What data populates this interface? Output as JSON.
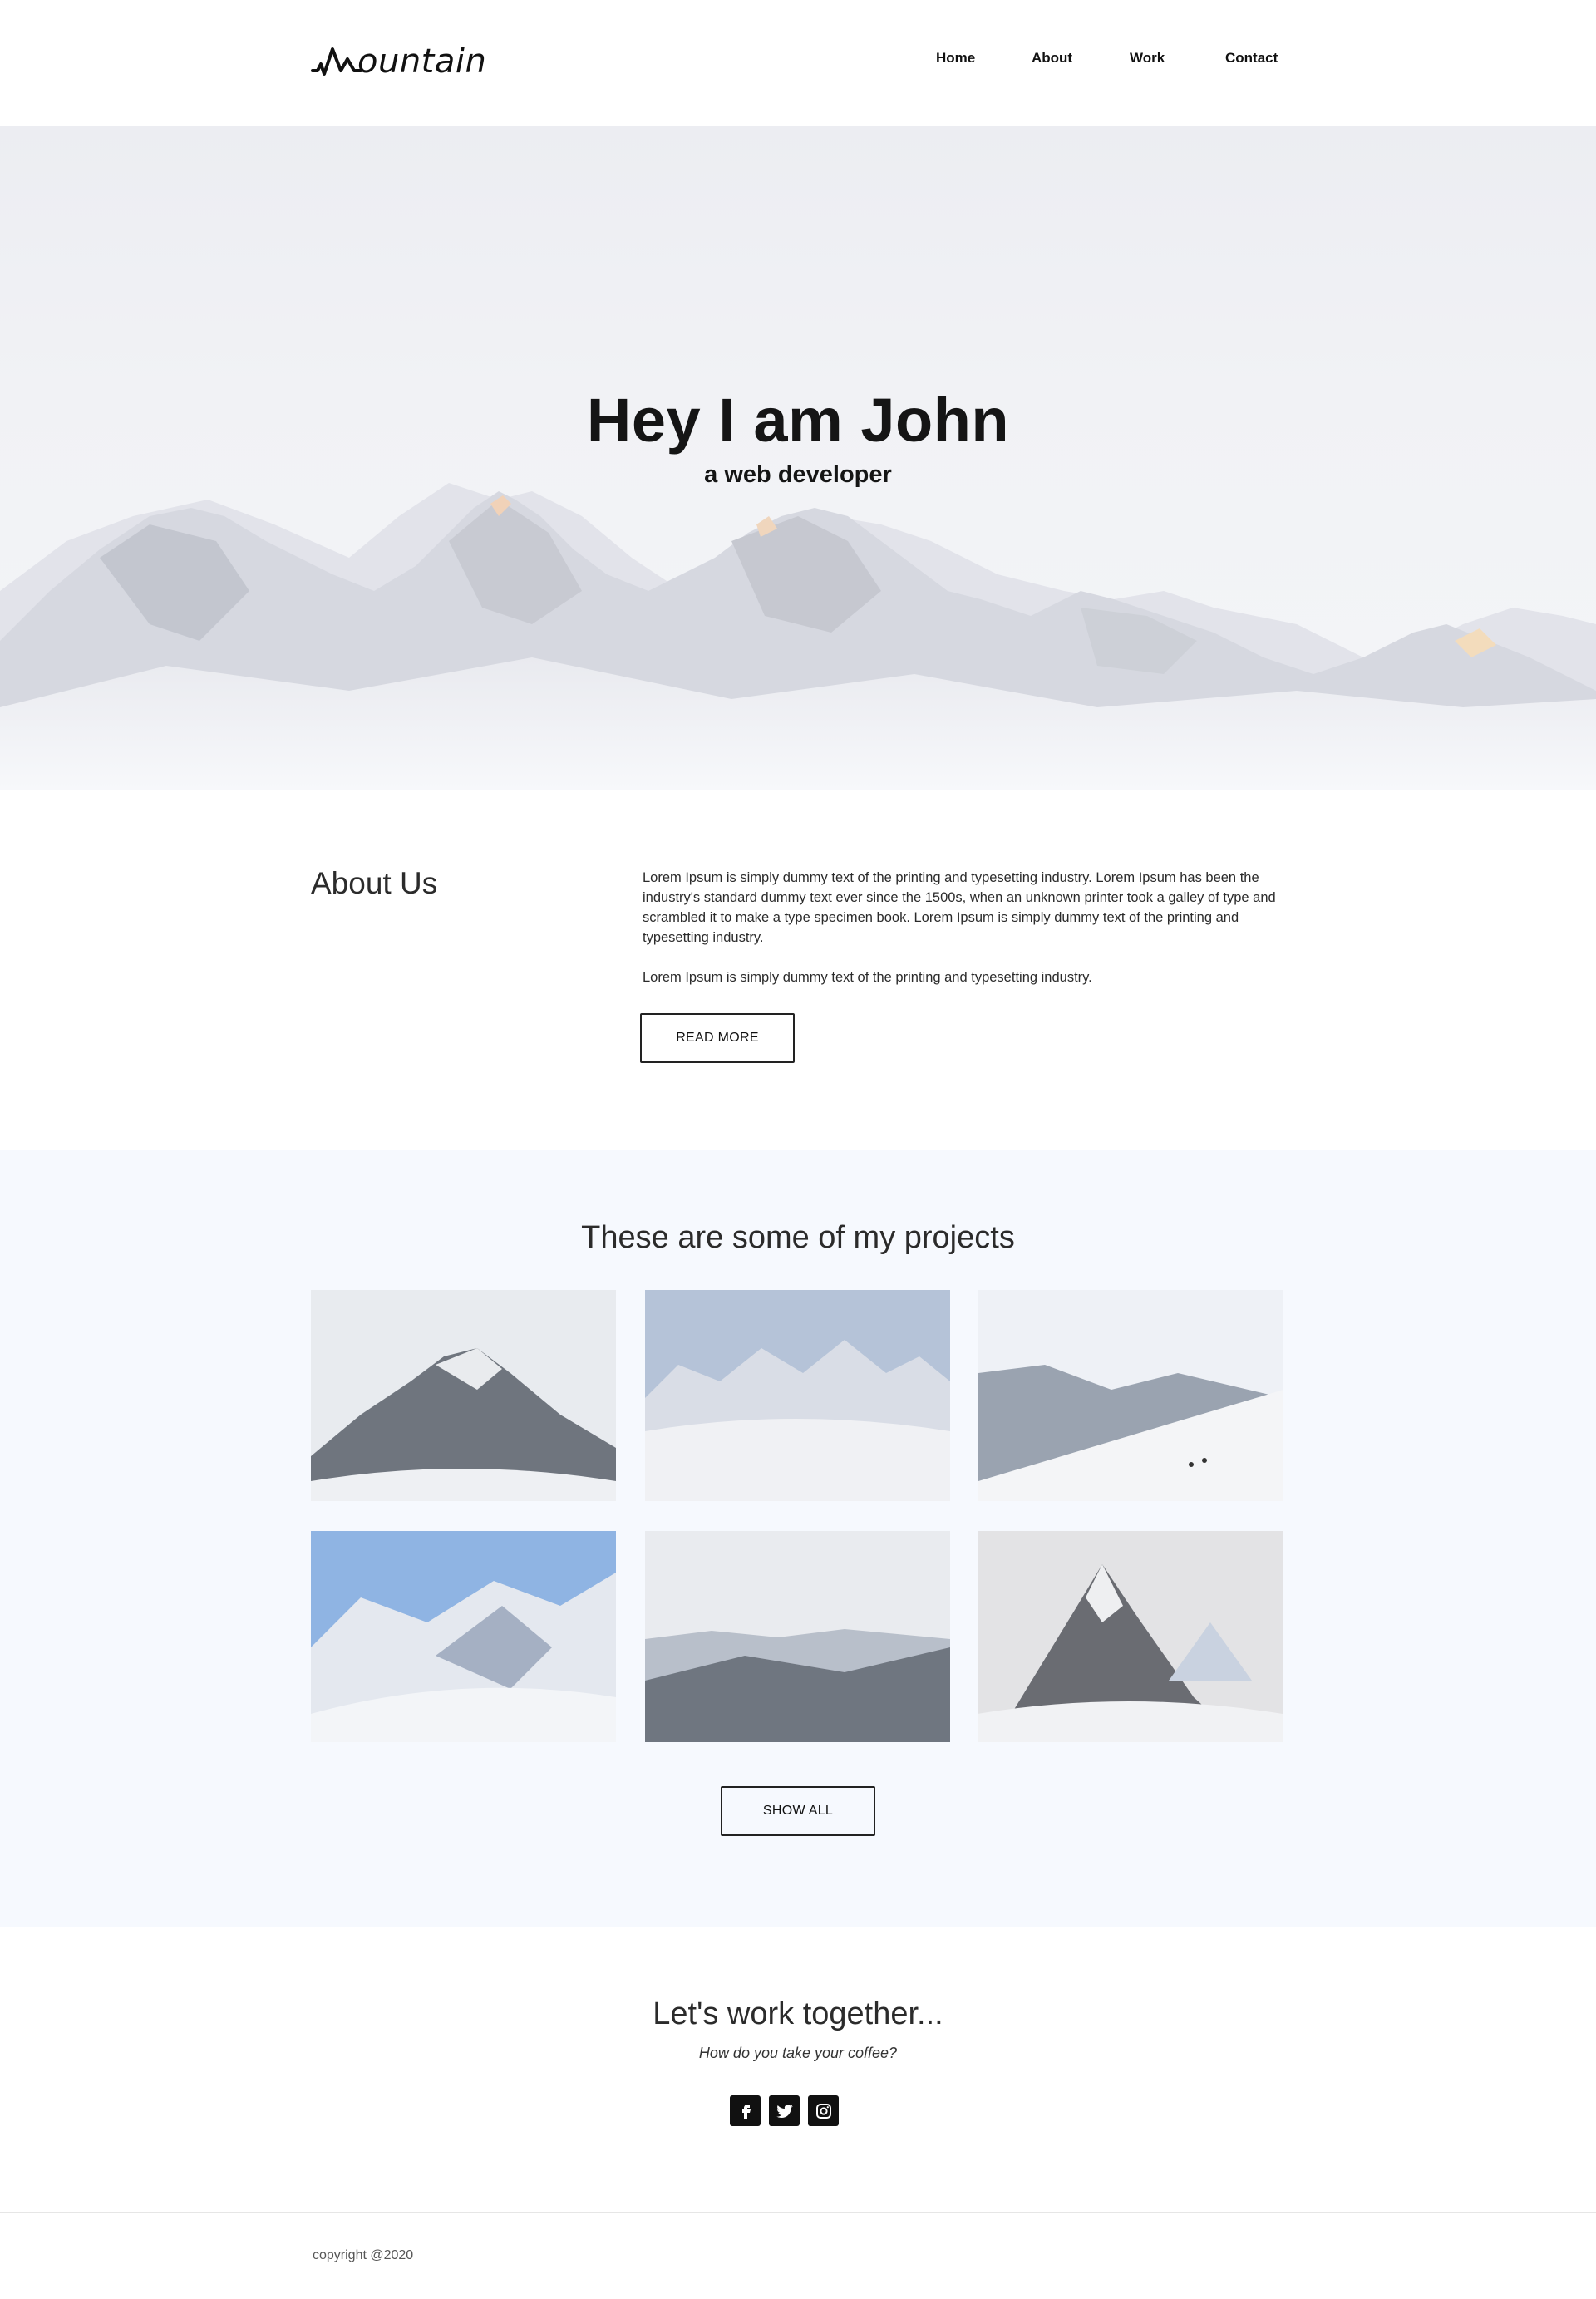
{
  "brand": {
    "name": "ountain",
    "logo_icon": "mountain-logo-icon"
  },
  "nav": {
    "items": [
      {
        "label": "Home"
      },
      {
        "label": "About"
      },
      {
        "label": "Work"
      },
      {
        "label": "Contact"
      }
    ]
  },
  "hero": {
    "title": "Hey I am John",
    "subtitle": "a web developer"
  },
  "about": {
    "heading": "About Us",
    "paragraph1": "Lorem Ipsum is simply dummy text of the printing and typesetting industry. Lorem Ipsum has been the industry's standard dummy text ever since the 1500s, when an unknown printer took a galley of type and scrambled it to make a type specimen book. Lorem Ipsum is simply dummy text of the printing and typesetting industry.",
    "paragraph2": "Lorem Ipsum is simply dummy text of the printing and typesetting industry.",
    "button_label": "READ MORE"
  },
  "projects": {
    "heading": "These are some of my projects",
    "button_label": "SHOW ALL"
  },
  "contact": {
    "heading": "Let's work together...",
    "subheading": "How do you take your coffee?",
    "socials": [
      "facebook-icon",
      "twitter-icon",
      "instagram-icon"
    ]
  },
  "footer": {
    "copyright": "copyright @2020"
  },
  "colors": {
    "text": "#1a1a1a",
    "projects_bg": "#f6f9fe",
    "hero_bg": "#eeeff3"
  }
}
